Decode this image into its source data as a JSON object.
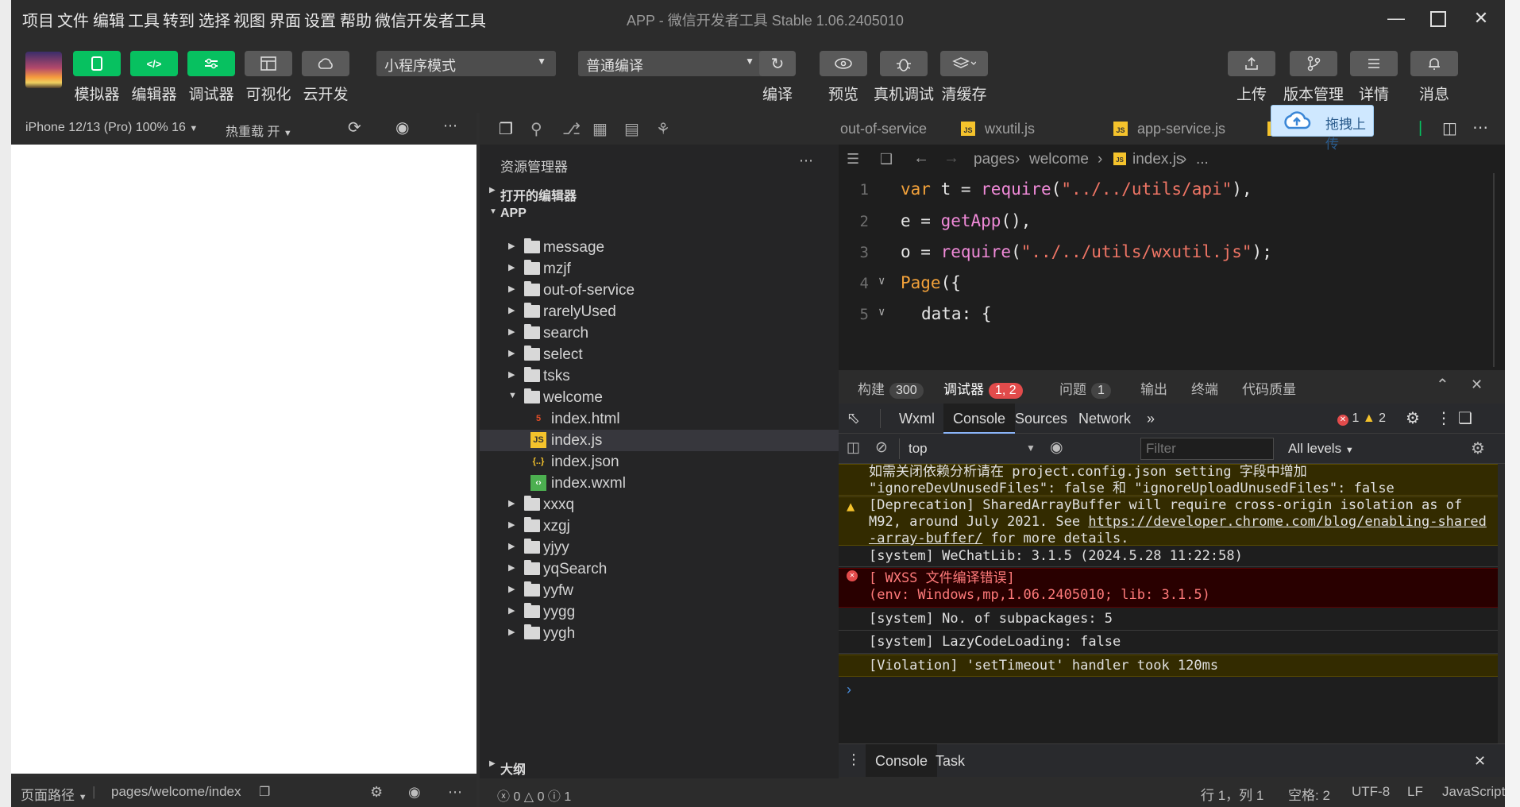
{
  "menu": [
    "项目",
    "文件",
    "编辑",
    "工具",
    "转到",
    "选择",
    "视图",
    "界面",
    "设置",
    "帮助",
    "微信开发者工具"
  ],
  "window_title": "APP - 微信开发者工具 Stable 1.06.2405010",
  "toolbar": {
    "left_buttons": [
      "模拟器",
      "编辑器",
      "调试器",
      "可视化",
      "云开发"
    ],
    "mode_select": "小程序模式",
    "compile_select": "普通编译",
    "mid_buttons": [
      "编译",
      "预览",
      "真机调试",
      "清缓存"
    ],
    "right_buttons": [
      "上传",
      "版本管理",
      "详情",
      "消息"
    ]
  },
  "simulator": {
    "device": "iPhone 12/13 (Pro) 100% 16",
    "hot_reload": "热重载 开",
    "page_path_label": "页面路径",
    "page_path": "pages/welcome/index"
  },
  "explorer": {
    "title": "资源管理器",
    "open_editors": "打开的编辑器",
    "project": "APP",
    "outline": "大纲",
    "tree": [
      {
        "name": "message",
        "type": "folder"
      },
      {
        "name": "mzjf",
        "type": "folder"
      },
      {
        "name": "out-of-service",
        "type": "folder"
      },
      {
        "name": "rarelyUsed",
        "type": "folder"
      },
      {
        "name": "search",
        "type": "folder"
      },
      {
        "name": "select",
        "type": "folder"
      },
      {
        "name": "tsks",
        "type": "folder"
      },
      {
        "name": "welcome",
        "type": "folder-open"
      },
      {
        "name": "index.html",
        "type": "html"
      },
      {
        "name": "index.js",
        "type": "js"
      },
      {
        "name": "index.json",
        "type": "json"
      },
      {
        "name": "index.wxml",
        "type": "wxml"
      },
      {
        "name": "xxxq",
        "type": "folder"
      },
      {
        "name": "xzgj",
        "type": "folder"
      },
      {
        "name": "yjyy",
        "type": "folder"
      },
      {
        "name": "yqSearch",
        "type": "folder"
      },
      {
        "name": "yyfw",
        "type": "folder"
      },
      {
        "name": "yygg",
        "type": "folder"
      },
      {
        "name": "yygh",
        "type": "folder"
      }
    ],
    "status_counts": [
      "0",
      "0",
      "1"
    ]
  },
  "editor": {
    "tabs": [
      "out-of-service",
      "wxutil.js",
      "app-service.js"
    ],
    "breadcrumb": [
      "pages",
      "welcome",
      "index.js",
      "..."
    ],
    "upload_popup": "拖拽上传"
  },
  "debugger": {
    "panel_tabs": [
      {
        "label": "构建",
        "badge": "300"
      },
      {
        "label": "调试器",
        "badge": "1, 2"
      },
      {
        "label": "问题",
        "badge": "1"
      },
      {
        "label": "输出",
        "badge": ""
      },
      {
        "label": "终端",
        "badge": ""
      },
      {
        "label": "代码质量",
        "badge": ""
      }
    ],
    "devtools_tabs": [
      "Wxml",
      "Console",
      "Sources",
      "Network"
    ],
    "error_count": "1",
    "warn_count": "2",
    "context": "top",
    "filter_placeholder": "Filter",
    "levels": "All levels",
    "drawer_tabs": [
      "Console",
      "Task"
    ]
  },
  "status": {
    "position": "行 1，列 1",
    "spaces": "空格: 2",
    "encoding": "UTF-8",
    "eol": "LF",
    "language": "JavaScript"
  },
  "colors": {
    "accent_green": "#07c160",
    "error_red": "#e24b4b",
    "warning_bg": "#332b00",
    "error_bg": "#290000"
  }
}
